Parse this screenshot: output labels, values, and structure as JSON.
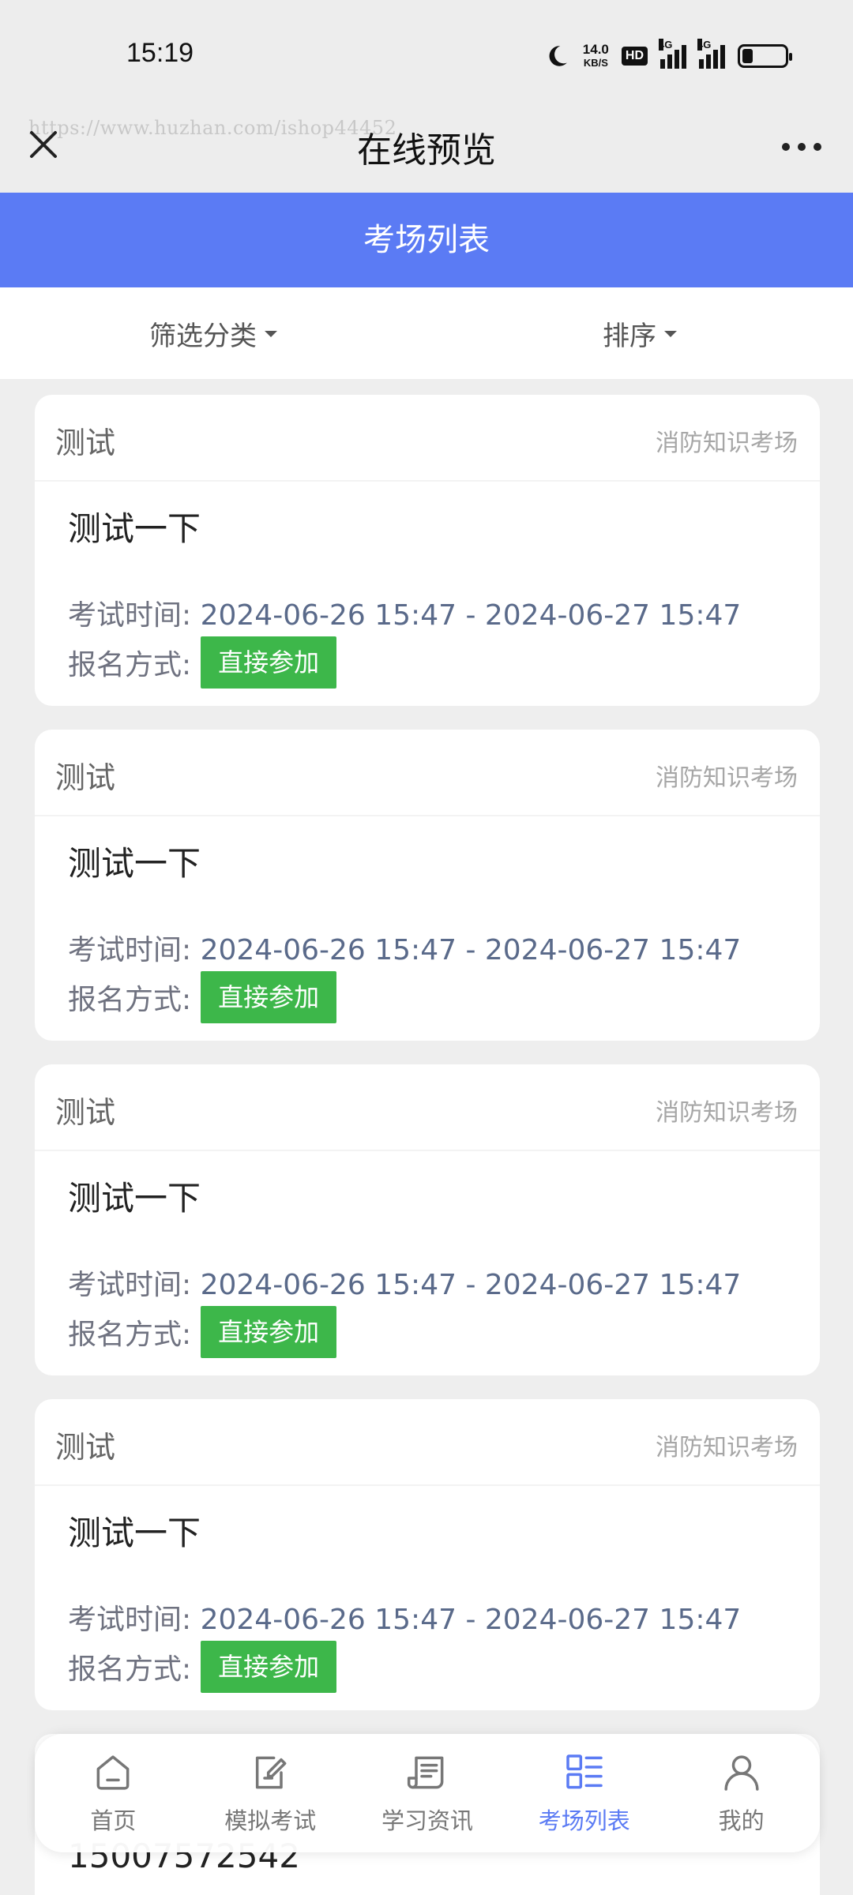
{
  "status_bar": {
    "time": "15:19",
    "net_speed_value": "14.0",
    "net_speed_unit": "KB/S",
    "hd_badge": "HD",
    "signal1_tag": "4G",
    "signal2_tag": "4G",
    "battery_level": 0.25
  },
  "title_bar": {
    "watermark": "https://www.huzhan.com/ishop44452",
    "title": "在线预览"
  },
  "header": {
    "title": "考场列表"
  },
  "filters": {
    "category_label": "筛选分类",
    "sort_label": "排序"
  },
  "cards": [
    {
      "category": "测试",
      "venue": "消防知识考场",
      "title": "测试一下",
      "time_label": "考试时间:",
      "time_value": "2024-06-26 15:47 - 2024-06-27 15:47",
      "signup_label": "报名方式:",
      "signup_button": "直接参加"
    },
    {
      "category": "测试",
      "venue": "消防知识考场",
      "title": "测试一下",
      "time_label": "考试时间:",
      "time_value": "2024-06-26 15:47 - 2024-06-27 15:47",
      "signup_label": "报名方式:",
      "signup_button": "直接参加"
    },
    {
      "category": "测试",
      "venue": "消防知识考场",
      "title": "测试一下",
      "time_label": "考试时间:",
      "time_value": "2024-06-26 15:47 - 2024-06-27 15:47",
      "signup_label": "报名方式:",
      "signup_button": "直接参加"
    },
    {
      "category": "测试",
      "venue": "消防知识考场",
      "title": "测试一下",
      "time_label": "考试时间:",
      "time_value": "2024-06-26 15:47 - 2024-06-27 15:47",
      "signup_label": "报名方式:",
      "signup_button": "直接参加"
    }
  ],
  "peek_card": {
    "text": "15007572542"
  },
  "tab_bar": {
    "items": [
      {
        "label": "首页",
        "icon": "home-icon"
      },
      {
        "label": "模拟考试",
        "icon": "edit-doc-icon"
      },
      {
        "label": "学习资讯",
        "icon": "news-icon"
      },
      {
        "label": "考场列表",
        "icon": "list-icon",
        "active": true
      },
      {
        "label": "我的",
        "icon": "user-icon"
      }
    ]
  },
  "colors": {
    "accent": "#5b7bf4",
    "join_button": "#3db74a",
    "background": "#eeeeee"
  }
}
